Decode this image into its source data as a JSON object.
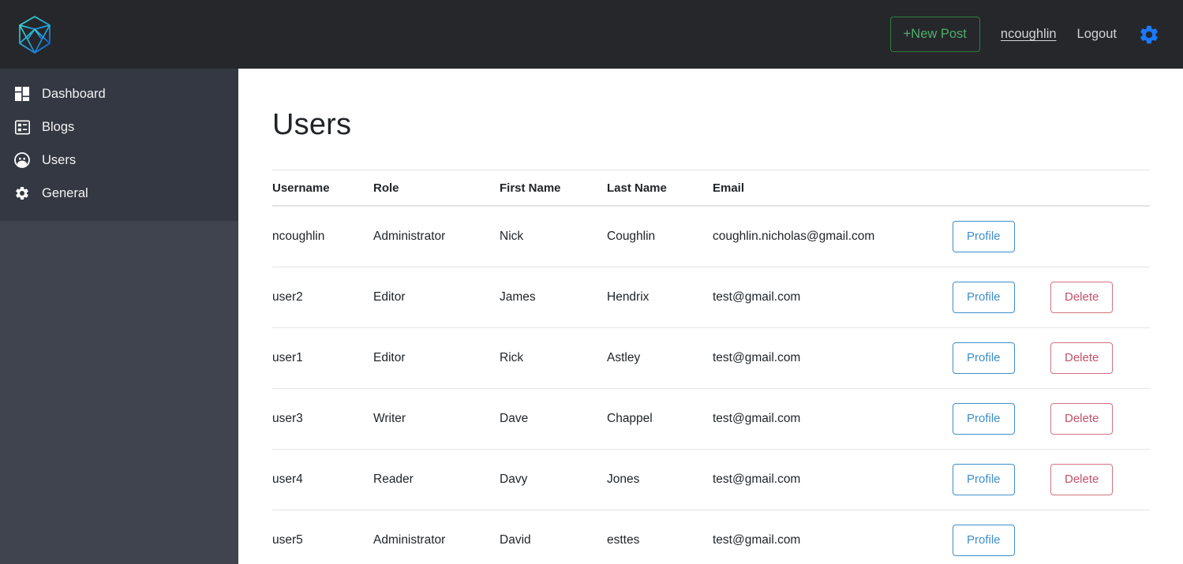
{
  "header": {
    "logo_icon": "polyhedron-logo-icon",
    "new_post_label": "+New Post",
    "username_link": "ncoughlin",
    "logout_label": "Logout",
    "settings_icon": "gear-icon",
    "colors": {
      "bar_background": "#26272b",
      "new_post_accent": "#4caf68",
      "gear_accent": "#1a7aff",
      "link_text": "#cfd2d6"
    }
  },
  "sidebar": {
    "background": "#40444e",
    "nav_background": "#343842",
    "items": [
      {
        "label": "Dashboard",
        "icon": "dashboard-grid-icon"
      },
      {
        "label": "Blogs",
        "icon": "list-blog-icon"
      },
      {
        "label": "Users",
        "icon": "user-circle-icon"
      },
      {
        "label": "General",
        "icon": "gear-icon"
      }
    ]
  },
  "main": {
    "page_title": "Users",
    "table": {
      "columns": [
        "Username",
        "Role",
        "First Name",
        "Last Name",
        "Email"
      ],
      "action_labels": {
        "profile": "Profile",
        "delete": "Delete"
      },
      "rows": [
        {
          "username": "ncoughlin",
          "role": "Administrator",
          "first_name": "Nick",
          "last_name": "Coughlin",
          "email": "coughlin.nicholas@gmail.com",
          "profile": "Profile",
          "delete": ""
        },
        {
          "username": "user2",
          "role": "Editor",
          "first_name": "James",
          "last_name": "Hendrix",
          "email": "test@gmail.com",
          "profile": "Profile",
          "delete": "Delete"
        },
        {
          "username": "user1",
          "role": "Editor",
          "first_name": "Rick",
          "last_name": "Astley",
          "email": "test@gmail.com",
          "profile": "Profile",
          "delete": "Delete"
        },
        {
          "username": "user3",
          "role": "Writer",
          "first_name": "Dave",
          "last_name": "Chappel",
          "email": "test@gmail.com",
          "profile": "Profile",
          "delete": "Delete"
        },
        {
          "username": "user4",
          "role": "Reader",
          "first_name": "Davy",
          "last_name": "Jones",
          "email": "test@gmail.com",
          "profile": "Profile",
          "delete": "Delete"
        },
        {
          "username": "user5",
          "role": "Administrator",
          "first_name": "David",
          "last_name": "esttes",
          "email": "test@gmail.com",
          "profile": "Profile",
          "delete": ""
        }
      ]
    }
  }
}
